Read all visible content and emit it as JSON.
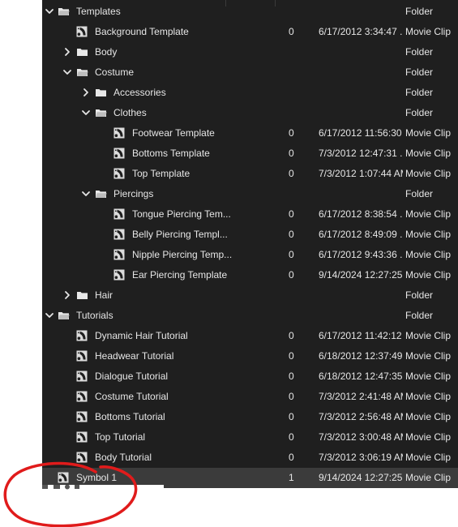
{
  "library": {
    "rows": [
      {
        "name": "Templates",
        "use_count": "",
        "date": "",
        "type": "Folder",
        "kind": "folder",
        "depth": 0,
        "expand": "open"
      },
      {
        "name": "Background Template",
        "use_count": "0",
        "date": "6/17/2012 3:34:47 ...",
        "type": "Movie Clip",
        "kind": "clip",
        "depth": 1,
        "expand": "none"
      },
      {
        "name": "Body",
        "use_count": "",
        "date": "",
        "type": "Folder",
        "kind": "folder",
        "depth": 1,
        "expand": "closed"
      },
      {
        "name": "Costume",
        "use_count": "",
        "date": "",
        "type": "Folder",
        "kind": "folder",
        "depth": 1,
        "expand": "open"
      },
      {
        "name": "Accessories",
        "use_count": "",
        "date": "",
        "type": "Folder",
        "kind": "folder",
        "depth": 2,
        "expand": "closed"
      },
      {
        "name": "Clothes",
        "use_count": "",
        "date": "",
        "type": "Folder",
        "kind": "folder",
        "depth": 2,
        "expand": "open"
      },
      {
        "name": "Footwear Template",
        "use_count": "0",
        "date": "6/17/2012 11:56:30 ...",
        "type": "Movie Clip",
        "kind": "clip",
        "depth": 3,
        "expand": "none"
      },
      {
        "name": "Bottoms Template",
        "use_count": "0",
        "date": "7/3/2012 12:47:31 ...",
        "type": "Movie Clip",
        "kind": "clip",
        "depth": 3,
        "expand": "none"
      },
      {
        "name": "Top Template",
        "use_count": "0",
        "date": "7/3/2012 1:07:44 AM",
        "type": "Movie Clip",
        "kind": "clip",
        "depth": 3,
        "expand": "none"
      },
      {
        "name": "Piercings",
        "use_count": "",
        "date": "",
        "type": "Folder",
        "kind": "folder",
        "depth": 2,
        "expand": "open"
      },
      {
        "name": "Tongue Piercing Tem...",
        "use_count": "0",
        "date": "6/17/2012 8:38:54 ...",
        "type": "Movie Clip",
        "kind": "clip",
        "depth": 3,
        "expand": "none"
      },
      {
        "name": "Belly Piercing Templ...",
        "use_count": "0",
        "date": "6/17/2012 8:49:09 ...",
        "type": "Movie Clip",
        "kind": "clip",
        "depth": 3,
        "expand": "none"
      },
      {
        "name": "Nipple Piercing Temp...",
        "use_count": "0",
        "date": "6/17/2012 9:43:36 ...",
        "type": "Movie Clip",
        "kind": "clip",
        "depth": 3,
        "expand": "none"
      },
      {
        "name": "Ear Piercing Template",
        "use_count": "0",
        "date": "9/14/2024 12:27:25...",
        "type": "Movie Clip",
        "kind": "clip",
        "depth": 3,
        "expand": "none"
      },
      {
        "name": "Hair",
        "use_count": "",
        "date": "",
        "type": "Folder",
        "kind": "folder",
        "depth": 1,
        "expand": "closed"
      },
      {
        "name": "Tutorials",
        "use_count": "",
        "date": "",
        "type": "Folder",
        "kind": "folder",
        "depth": 0,
        "expand": "open"
      },
      {
        "name": "Dynamic Hair Tutorial",
        "use_count": "0",
        "date": "6/17/2012 11:42:12 ...",
        "type": "Movie Clip",
        "kind": "clip",
        "depth": 1,
        "expand": "none"
      },
      {
        "name": "Headwear Tutorial",
        "use_count": "0",
        "date": "6/18/2012 12:37:49...",
        "type": "Movie Clip",
        "kind": "clip",
        "depth": 1,
        "expand": "none"
      },
      {
        "name": "Dialogue Tutorial",
        "use_count": "0",
        "date": "6/18/2012 12:47:35...",
        "type": "Movie Clip",
        "kind": "clip",
        "depth": 1,
        "expand": "none"
      },
      {
        "name": "Costume Tutorial",
        "use_count": "0",
        "date": "7/3/2012 2:41:48 AM",
        "type": "Movie Clip",
        "kind": "clip",
        "depth": 1,
        "expand": "none"
      },
      {
        "name": "Bottoms Tutorial",
        "use_count": "0",
        "date": "7/3/2012 2:56:48 AM",
        "type": "Movie Clip",
        "kind": "clip",
        "depth": 1,
        "expand": "none"
      },
      {
        "name": "Top Tutorial",
        "use_count": "0",
        "date": "7/3/2012 3:00:48 AM",
        "type": "Movie Clip",
        "kind": "clip",
        "depth": 1,
        "expand": "none"
      },
      {
        "name": "Body Tutorial",
        "use_count": "0",
        "date": "7/3/2012 3:06:19 AM",
        "type": "Movie Clip",
        "kind": "clip",
        "depth": 1,
        "expand": "none"
      },
      {
        "name": "Symbol 1",
        "use_count": "1",
        "date": "9/14/2024 12:27:25...",
        "type": "Movie Clip",
        "kind": "clip",
        "depth": 0,
        "expand": "none",
        "selected": true
      }
    ]
  },
  "colors": {
    "panel_bg": "#1f1f1f",
    "selected_row": "#3b3b3b",
    "text": "#e6e6e6",
    "annotation": "#e01b1b"
  },
  "icons": {
    "folder": "folder-icon",
    "clip": "movie-clip-icon",
    "expand_open": "chevron-down-icon",
    "expand_closed": "chevron-right-icon"
  }
}
